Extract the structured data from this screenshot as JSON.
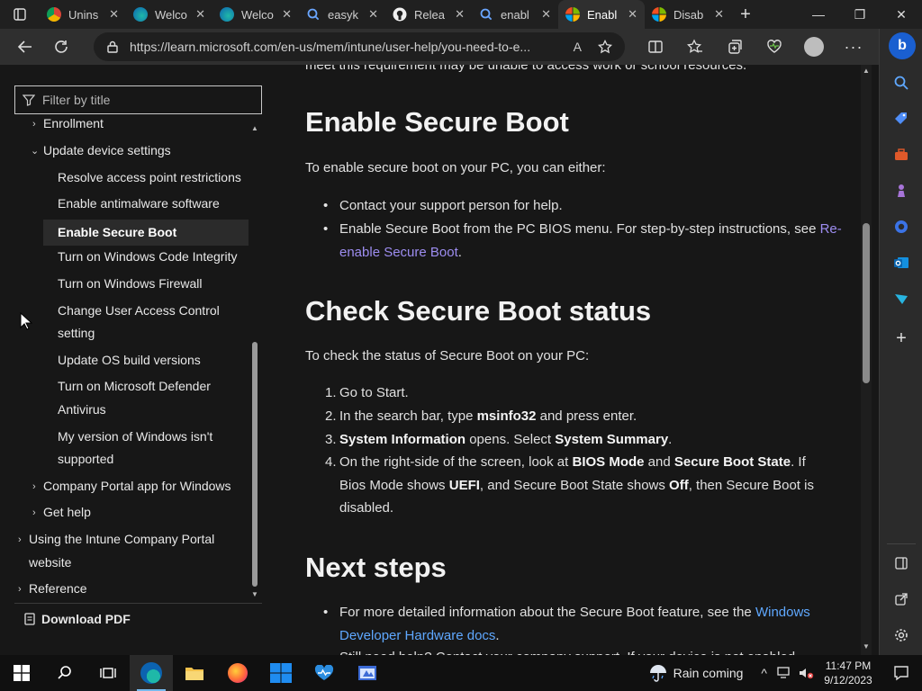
{
  "browser": {
    "tabs": [
      {
        "label": "Unins",
        "icon": "chrome-icon"
      },
      {
        "label": "Welco",
        "icon": "edge-icon"
      },
      {
        "label": "Welco",
        "icon": "edge-icon"
      },
      {
        "label": "easyk",
        "icon": "search-icon"
      },
      {
        "label": "Relea",
        "icon": "github-icon"
      },
      {
        "label": "enabl",
        "icon": "search-icon"
      },
      {
        "label": "Enabl",
        "icon": "microsoft-icon",
        "active": true
      },
      {
        "label": "Disab",
        "icon": "microsoft-icon"
      }
    ],
    "url": "https://learn.microsoft.com/en-us/mem/intune/user-help/you-need-to-e..."
  },
  "toc": {
    "filter_placeholder": "Filter by title",
    "items": [
      "Enrollment",
      "Update device settings",
      "Resolve access point restrictions",
      "Enable antimalware software",
      "Enable Secure Boot",
      "Turn on Windows Code Integrity",
      "Turn on Windows Firewall",
      "Change User Access Control",
      "setting",
      "Update OS build versions",
      "Turn on Microsoft Defender",
      "Antivirus",
      "My version of Windows isn't",
      "supported",
      "Company Portal app for Windows",
      "Get help",
      "Using the Intune Company Portal",
      "website",
      "Reference"
    ],
    "download_label": "Download PDF"
  },
  "article": {
    "clipped_text": "meet this requirement may be unable to access work or school resources.",
    "h_enable": "Enable Secure Boot",
    "p_enable": "To enable secure boot on your PC, you can either:",
    "enable_b1": "Contact your support person for help.",
    "enable_b2_text": "Enable Secure Boot from the PC BIOS menu. For step-by-step instructions, see",
    "enable_b2_link": "Re-enable Secure Boot",
    "enable_b2_end": ".",
    "h_check": "Check Secure Boot status",
    "p_check": "To check the status of Secure Boot on your PC:",
    "s1": "Go to Start.",
    "s2_a": "In the search bar, type ",
    "s2_b": "msinfo32",
    "s2_c": " and press enter.",
    "s3_a": "System Information",
    "s3_b": " opens. Select ",
    "s3_c": "System Summary",
    "s3_d": ".",
    "s4_a": "On the right-side of the screen, look at ",
    "s4_b": "BIOS Mode",
    "s4_c": " and ",
    "s4_d": "Secure Boot State",
    "s4_e": ". If",
    "s4_f": "Bios Mode shows ",
    "s4_g": "UEFI",
    "s4_h": ", and Secure Boot State shows ",
    "s4_i": "Off",
    "s4_j": ", then Secure Boot is",
    "s4_k": "disabled.",
    "h_next": "Next steps",
    "next_b1_text": "For more detailed information about the Secure Boot feature, see the",
    "next_b1_link1": "Windows",
    "next_b1_link2": "Developer Hardware docs",
    "next_b1_end": ".",
    "next_b2_clipped": "Still need help? Contact your company support. If your device is not enabled..."
  },
  "taskbar": {
    "weather": "Rain coming",
    "time": "11:47 PM",
    "date": "9/12/2023"
  },
  "colors": {
    "accent": "#76b9ed",
    "link_visited": "#9d8df0",
    "link": "#5fa8ff"
  }
}
